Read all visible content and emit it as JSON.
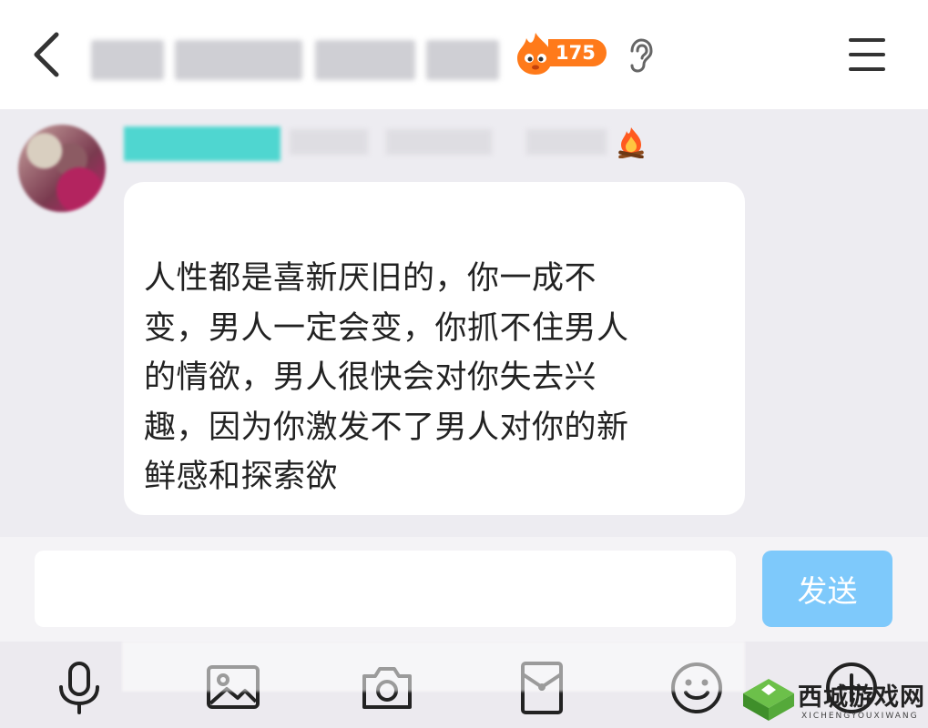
{
  "header": {
    "fire_count": "175",
    "back_icon": "chevron-left-icon",
    "menu_icon": "hamburger-menu-icon",
    "ear_icon": "ear-icon"
  },
  "message": {
    "text": "人性都是喜新厌旧的，你一成不变，男人一定会变，你抓不住男人的情欲，男人很快会对你失去兴趣，因为你激发不了男人对你的新鲜感和探索欲",
    "lines": [
      "人性都是喜新厌旧的，你一成不",
      "变，男人一定会变，你抓不住男人",
      "的情欲，男人很快会对你失去兴",
      "趣，因为你激发不了男人对你的新",
      "鲜感和探索欲"
    ]
  },
  "input": {
    "value": "",
    "placeholder": "",
    "send_label": "发送"
  },
  "toolbar": {
    "icons": [
      "microphone-icon",
      "image-icon",
      "camera-icon",
      "red-envelope-icon",
      "emoji-icon",
      "plus-icon"
    ]
  },
  "watermark": {
    "title": "西城游戏网",
    "subtitle": "XICHENGYOUXIWANG"
  },
  "colors": {
    "accent_send": "#7ec9fb",
    "fire_orange": "#ff7a1a",
    "name_tag": "#4fd6d0",
    "background": "#edecf1"
  }
}
